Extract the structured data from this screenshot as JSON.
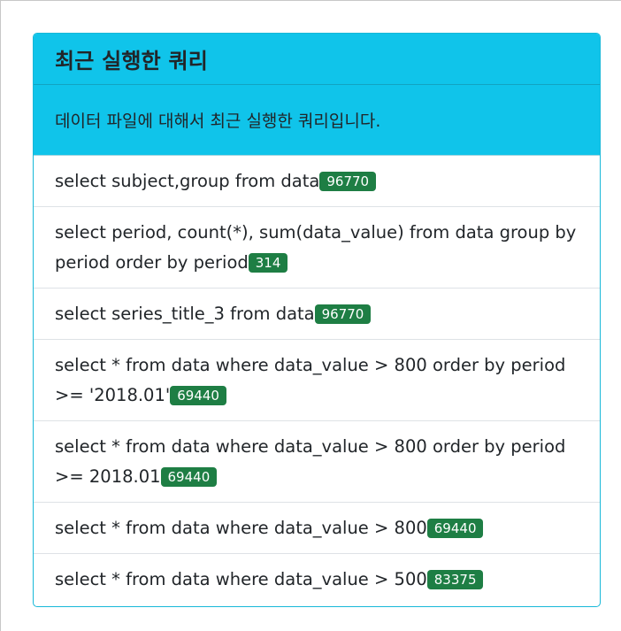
{
  "card": {
    "title": "최근 실행한 쿼리",
    "subtitle": "데이터 파일에 대해서 최근 실행한 쿼리입니다."
  },
  "queries": [
    {
      "text": "select subject,group from data",
      "count": "96770"
    },
    {
      "text": "select period, count(*), sum(data_value) from data group by period order by period",
      "count": "314"
    },
    {
      "text": "select series_title_3 from data",
      "count": "96770"
    },
    {
      "text": "select * from data where data_value > 800 order by period >= '2018.01'",
      "count": "69440"
    },
    {
      "text": "select * from data where data_value > 800 order by period >= 2018.01",
      "count": "69440"
    },
    {
      "text": "select * from data where data_value > 800",
      "count": "69440"
    },
    {
      "text": "select * from data where data_value > 500",
      "count": "83375"
    }
  ],
  "colors": {
    "header_bg": "#10c4ea",
    "badge_bg": "#1e7e44",
    "border": "#17b8d8"
  }
}
